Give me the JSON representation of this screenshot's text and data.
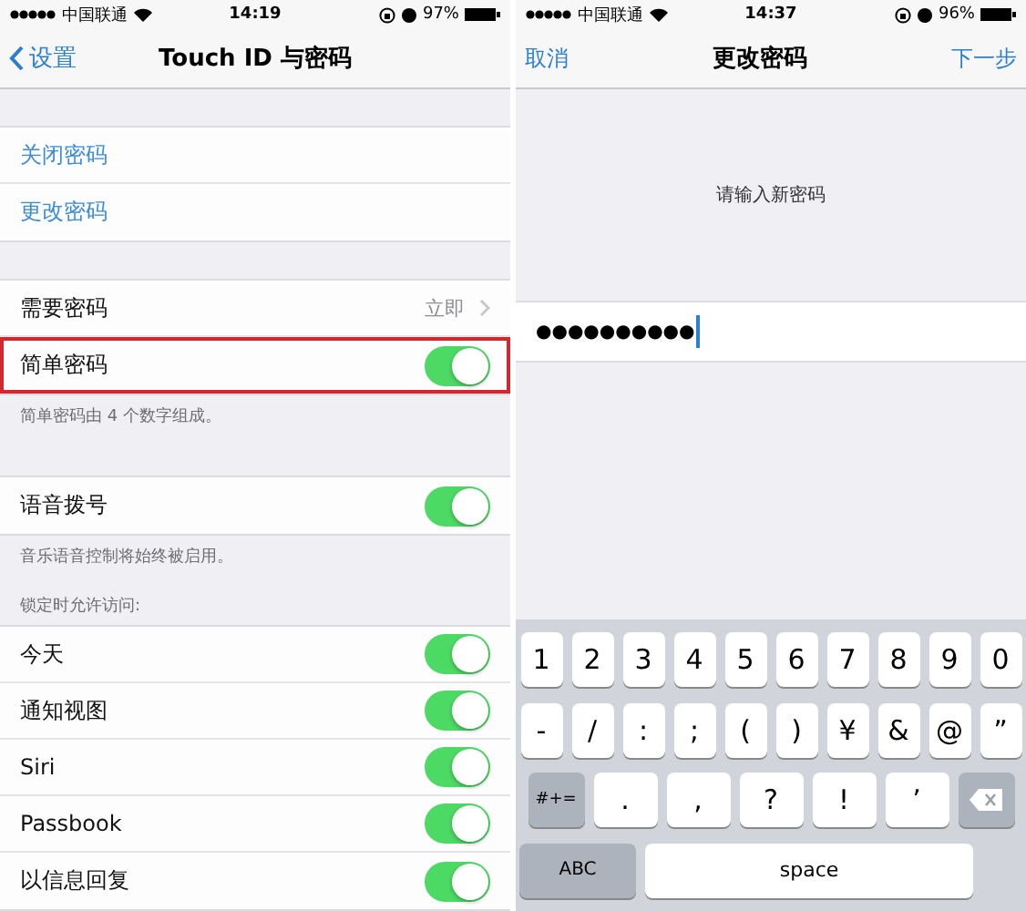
{
  "settings_screen": {
    "status_bar": {
      "carrier": "中国联通",
      "time": "14:19",
      "battery": "97%"
    },
    "nav": {
      "back": "设置",
      "title": "Touch ID 与密码"
    },
    "groups": [
      {
        "rows": [
          {
            "kind": "link",
            "label": "关闭密码"
          },
          {
            "kind": "link",
            "label": "更改密码"
          }
        ]
      },
      {
        "rows": [
          {
            "kind": "detail",
            "label": "需要密码",
            "value": "立即"
          },
          {
            "kind": "switch",
            "label": "简单密码",
            "on": true,
            "highlighted": true
          }
        ],
        "footer": "简单密码由 4 个数字组成。"
      },
      {
        "rows": [
          {
            "kind": "switch",
            "label": "语音拨号",
            "on": true,
            "highlighted": false
          }
        ],
        "footer": "音乐语音控制将始终被启用。"
      },
      {
        "header": "锁定时允许访问:",
        "rows": [
          {
            "kind": "switch",
            "label": "今天",
            "on": true,
            "highlighted": false
          },
          {
            "kind": "switch",
            "label": "通知视图",
            "on": true,
            "highlighted": false
          },
          {
            "kind": "switch",
            "label": "Siri",
            "on": true,
            "highlighted": false
          },
          {
            "kind": "switch",
            "label": "Passbook",
            "on": true,
            "highlighted": false
          },
          {
            "kind": "switch",
            "label": "以信息回复",
            "on": true,
            "highlighted": false
          }
        ]
      }
    ]
  },
  "change_passcode_screen": {
    "status_bar": {
      "carrier": "中国联通",
      "time": "14:37",
      "battery": "96%"
    },
    "nav": {
      "left": "取消",
      "title": "更改密码",
      "right": "下一步"
    },
    "prompt": "请输入新密码",
    "field_value": "●●●●●●●●●●",
    "keyboard": [
      [
        {
          "kind": "char",
          "label": "1"
        },
        {
          "kind": "char",
          "label": "2"
        },
        {
          "kind": "char",
          "label": "3"
        },
        {
          "kind": "char",
          "label": "4"
        },
        {
          "kind": "char",
          "label": "5"
        },
        {
          "kind": "char",
          "label": "6"
        },
        {
          "kind": "char",
          "label": "7"
        },
        {
          "kind": "char",
          "label": "8"
        },
        {
          "kind": "char",
          "label": "9"
        },
        {
          "kind": "char",
          "label": "0"
        }
      ],
      [
        {
          "kind": "char",
          "label": "-"
        },
        {
          "kind": "char",
          "label": "/"
        },
        {
          "kind": "char",
          "label": ":"
        },
        {
          "kind": "char",
          "label": ";"
        },
        {
          "kind": "char",
          "label": "("
        },
        {
          "kind": "char",
          "label": ")"
        },
        {
          "kind": "char",
          "label": "¥"
        },
        {
          "kind": "char",
          "label": "&"
        },
        {
          "kind": "char",
          "label": "@"
        },
        {
          "kind": "char",
          "label": "”"
        }
      ],
      [
        {
          "kind": "function",
          "label": "#+="
        },
        {
          "kind": "wide",
          "label": "."
        },
        {
          "kind": "wide",
          "label": ","
        },
        {
          "kind": "wide",
          "label": "?"
        },
        {
          "kind": "wide",
          "label": "!"
        },
        {
          "kind": "wide",
          "label": "’"
        },
        {
          "kind": "delete"
        }
      ],
      [
        {
          "kind": "function",
          "label": "ABC"
        },
        {
          "kind": "space",
          "label": "space"
        }
      ]
    ]
  }
}
